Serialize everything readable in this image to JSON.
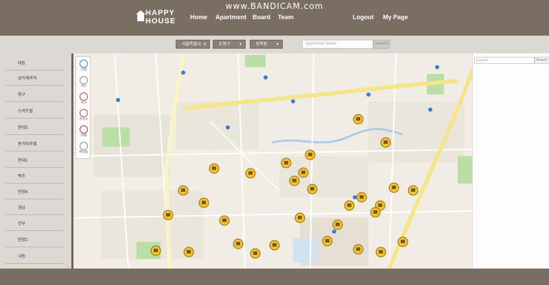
{
  "watermark": "www.BANDICAM.com",
  "header": {
    "logo_line1": "HAPPY",
    "logo_line2": "HOUSE",
    "nav": {
      "home": "Home",
      "apartment": "Apartment",
      "board": "Board",
      "team": "Team",
      "logout": "Logout",
      "mypage": "My Page"
    }
  },
  "filters": {
    "city": "서울특별시",
    "district": "도봉구",
    "dong": "방학동",
    "search_placeholder": "Apartment Name",
    "search_button": "Search"
  },
  "sidebar": {
    "items": [
      "대동",
      "삼익세라믹",
      "청구",
      "스카트빌",
      "현대3",
      "동익미라벨",
      "현대1",
      "벽조",
      "한양6",
      "경남",
      "선우",
      "한양2",
      "극동"
    ]
  },
  "map": {
    "controls": [
      "은행",
      "마트",
      "약국",
      "주유소",
      "카페",
      "편의점"
    ],
    "marker_count": 30,
    "marker_color": "#f2c12e",
    "road_color": "#f5e58a",
    "park_color": "#b9dfa6",
    "water_color": "#a9cce8"
  },
  "right_panel": {
    "keyword_placeholder": "keyword",
    "search_button": "Search"
  },
  "colors": {
    "header_bg": "#7a6e63",
    "panel_bg": "#dcd8d4",
    "select_bg": "#8c8178"
  }
}
